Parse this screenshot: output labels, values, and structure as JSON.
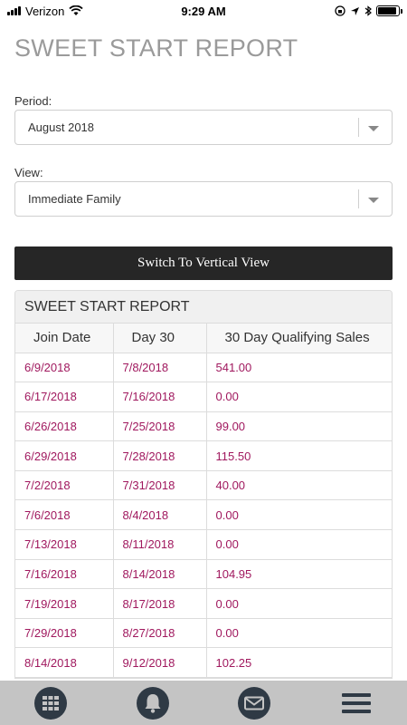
{
  "status_bar": {
    "carrier": "Verizon",
    "time": "9:29 AM",
    "battery_level": 0.9
  },
  "page": {
    "title": "SWEET START REPORT"
  },
  "filters": {
    "period_label": "Period:",
    "period_value": "August 2018",
    "view_label": "View:",
    "view_value": "Immediate Family"
  },
  "switch_button": {
    "label": "Switch To Vertical View"
  },
  "report": {
    "title": "SWEET START REPORT",
    "columns": [
      "Join Date",
      "Day 30",
      "30 Day Qualifying Sales"
    ],
    "rows": [
      [
        "6/9/2018",
        "7/8/2018",
        "541.00"
      ],
      [
        "6/17/2018",
        "7/16/2018",
        "0.00"
      ],
      [
        "6/26/2018",
        "7/25/2018",
        "99.00"
      ],
      [
        "6/29/2018",
        "7/28/2018",
        "115.50"
      ],
      [
        "7/2/2018",
        "7/31/2018",
        "40.00"
      ],
      [
        "7/6/2018",
        "8/4/2018",
        "0.00"
      ],
      [
        "7/13/2018",
        "8/11/2018",
        "0.00"
      ],
      [
        "7/16/2018",
        "8/14/2018",
        "104.95"
      ],
      [
        "7/19/2018",
        "8/17/2018",
        "0.00"
      ],
      [
        "7/29/2018",
        "8/27/2018",
        "0.00"
      ],
      [
        "8/14/2018",
        "9/12/2018",
        "102.25"
      ]
    ]
  },
  "bottom_nav": {
    "items": [
      "grid-icon",
      "bell-icon",
      "mail-icon",
      "menu-icon"
    ]
  },
  "colors": {
    "accent": "#a0185e",
    "button_dark": "#262626",
    "nav_bar": "#c4c4c4",
    "nav_icon": "#2f3a45"
  }
}
